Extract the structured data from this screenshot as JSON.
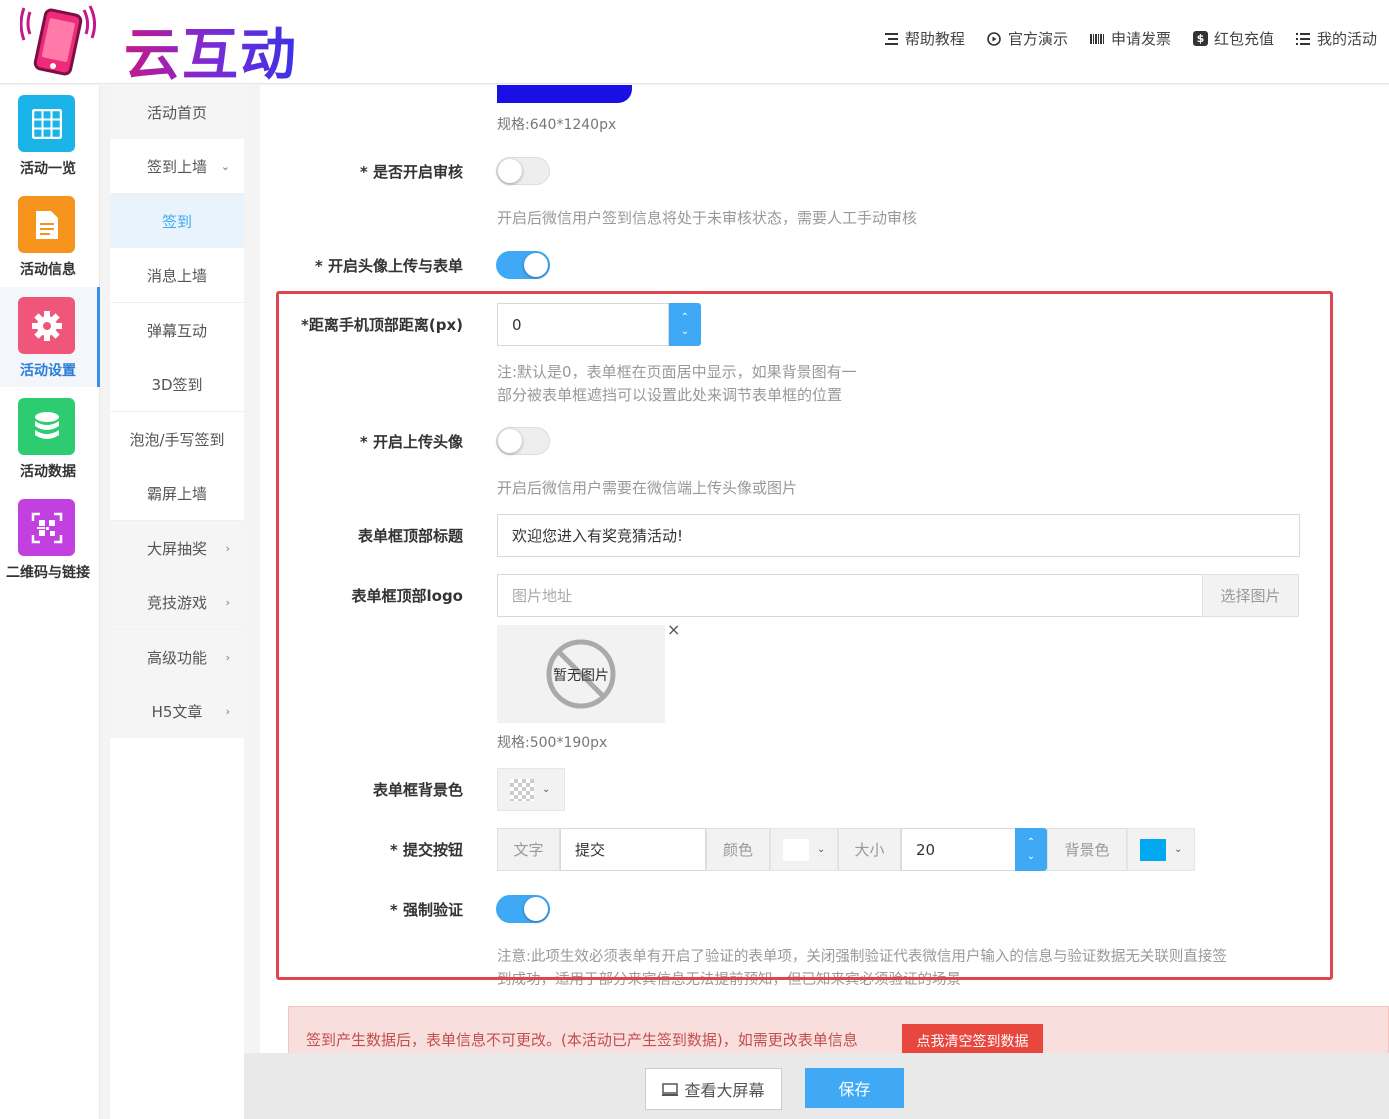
{
  "header": {
    "logo_text": "云互动",
    "nav": [
      {
        "label": "帮助教程",
        "icon": "list-icon"
      },
      {
        "label": "官方演示",
        "icon": "play-circle-icon"
      },
      {
        "label": "申请发票",
        "icon": "barcode-icon"
      },
      {
        "label": "红包充值",
        "icon": "dollar-icon"
      },
      {
        "label": "我的活动",
        "icon": "bullet-list-icon"
      }
    ]
  },
  "sidebar": {
    "items": [
      {
        "label": "活动一览",
        "icon": "grid-icon",
        "color": "#1ab4e8"
      },
      {
        "label": "活动信息",
        "icon": "document-icon",
        "color": "#f7941d"
      },
      {
        "label": "活动设置",
        "icon": "gear-icon",
        "color": "#f0557a"
      },
      {
        "label": "活动数据",
        "icon": "database-icon",
        "color": "#2ecc71"
      },
      {
        "label": "二维码与链接",
        "icon": "qrcode-icon",
        "color": "#c23fe0"
      }
    ]
  },
  "submenu": {
    "items": [
      {
        "label": "活动首页"
      },
      {
        "label": "签到上墙",
        "arrow": "⌄"
      },
      {
        "label": "签到"
      },
      {
        "label": "消息上墙"
      },
      {
        "label": "弹幕互动"
      },
      {
        "label": "3D签到"
      },
      {
        "label": "泡泡/手写签到"
      },
      {
        "label": "霸屏上墙"
      },
      {
        "label": "大屏抽奖",
        "arrow": "›"
      },
      {
        "label": "竞技游戏",
        "arrow": "›"
      },
      {
        "label": "高级功能",
        "arrow": "›"
      },
      {
        "label": "H5文章",
        "arrow": "›"
      }
    ]
  },
  "form": {
    "bg_spec": "规格:640*1240px",
    "review_label": "* 是否开启审核",
    "review_on": false,
    "review_hint": "开启后微信用户签到信息将处于未审核状态，需要人工手动审核",
    "avatar_form_label": "* 开启头像上传与表单",
    "avatar_form_on": true,
    "top_dist_label": "*距离手机顶部距离(px)",
    "top_dist_value": "0",
    "top_dist_hint_1": "注:默认是0，表单框在页面居中显示，如果背景图有一",
    "top_dist_hint_2": "部分被表单框遮挡可以设置此处来调节表单框的位置",
    "upload_avatar_label": "* 开启上传头像",
    "upload_avatar_on": false,
    "upload_avatar_hint": "开启后微信用户需要在微信端上传头像或图片",
    "top_title_label": "表单框顶部标题",
    "top_title_value": "欢迎您进入有奖竞猜活动!",
    "top_logo_label": "表单框顶部logo",
    "top_logo_placeholder": "图片地址",
    "choose_image": "选择图片",
    "no_image": "暂无图片",
    "close": "×",
    "logo_spec": "规格:500*190px",
    "bg_color_label": "表单框背景色",
    "submit_label": "* 提交按钮",
    "submit_text_addon": "文字",
    "submit_text_value": "提交",
    "submit_color_addon": "颜色",
    "submit_color": "#ffffff",
    "submit_size_addon": "大小",
    "submit_size_value": "20",
    "submit_bg_addon": "背景色",
    "submit_bg_color": "#00a8f0",
    "force_verify_label": "* 强制验证",
    "force_verify_on": true,
    "force_verify_hint_1": "注意:此项生效必须表单有开启了验证的表单项，关闭强制验证代表微信用户输入的信息与验证数据无关联则直接签",
    "force_verify_hint_2": "到成功，适用于部分来宾信息无法提前预知，但已知来宾必须验证的场景"
  },
  "alert": {
    "text": "签到产生数据后，表单信息不可更改。(本活动已产生签到数据)，如需更改表单信息",
    "button": "点我清空签到数据"
  },
  "footer": {
    "preview": "查看大屏幕",
    "save": "保存"
  },
  "colors": {
    "accent": "#3fa9f5",
    "highlight_box": "#e0444c"
  }
}
